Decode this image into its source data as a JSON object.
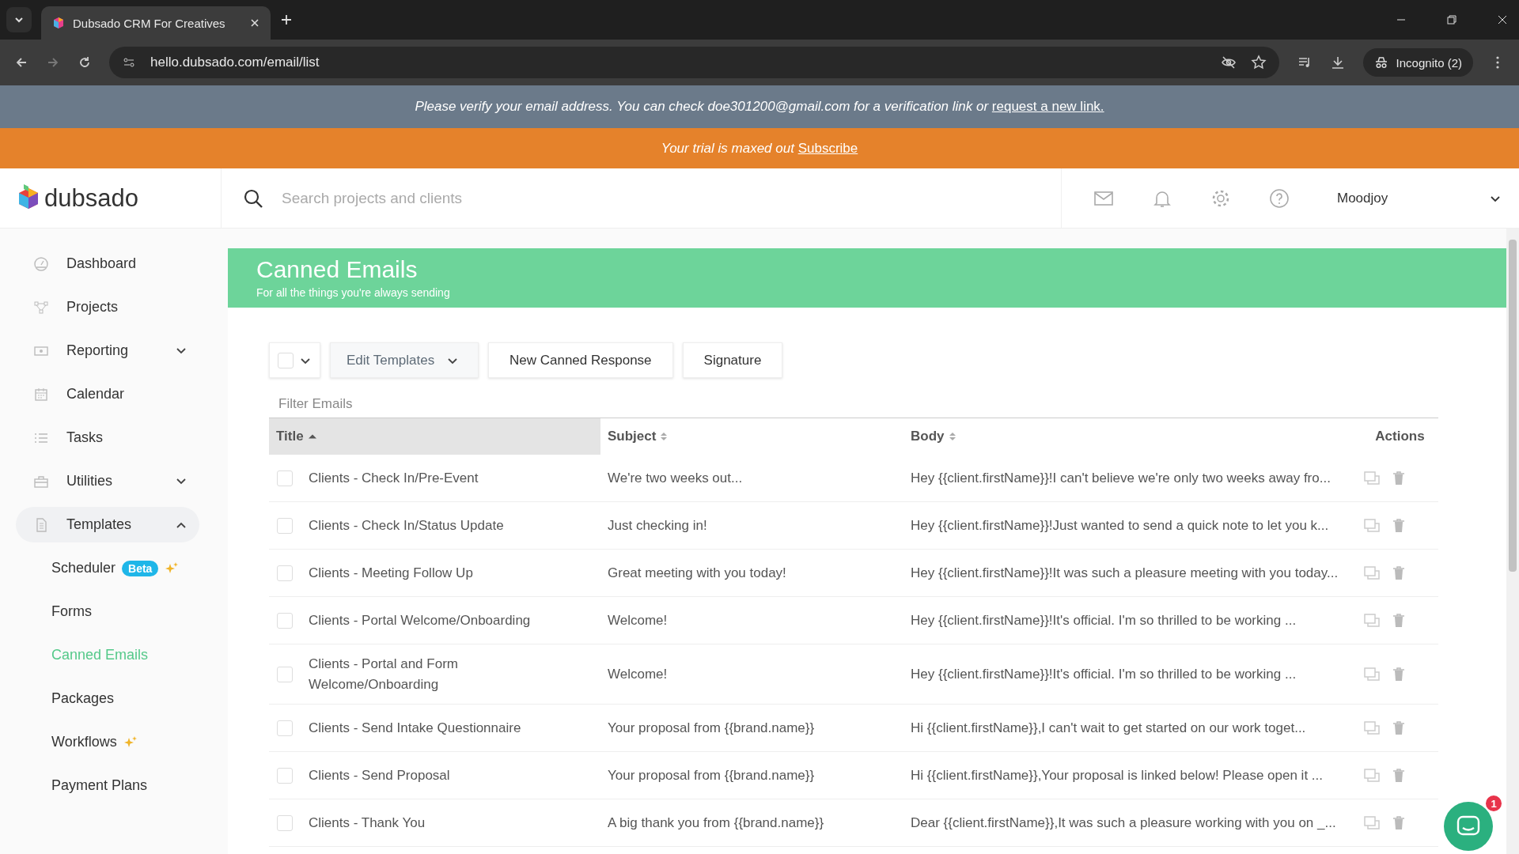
{
  "browser": {
    "tab_title": "Dubsado CRM For Creatives",
    "url": "hello.dubsado.com/email/list",
    "profile": "Incognito (2)"
  },
  "verify_banner": {
    "text": "Please verify your email address. You can check doe301200@gmail.com for a verification link or",
    "link": "request a new link."
  },
  "trial_banner": {
    "text": "Your trial is maxed out",
    "link": "Subscribe"
  },
  "header": {
    "logo": "dubsado",
    "search": {
      "placeholder": "Search projects and clients"
    },
    "user": "Moodjoy"
  },
  "sidebar": {
    "items": [
      {
        "label": "Dashboard",
        "selected": false
      },
      {
        "label": "Projects",
        "selected": false
      },
      {
        "label": "Reporting",
        "selected": false,
        "expanded": false
      },
      {
        "label": "Calendar",
        "selected": false
      },
      {
        "label": "Tasks",
        "selected": false
      },
      {
        "label": "Utilities",
        "selected": false,
        "expanded": false
      },
      {
        "label": "Templates",
        "selected": false,
        "expanded": true,
        "children": [
          {
            "label": "Scheduler",
            "badge": "Beta",
            "sparkle": true,
            "selected": false
          },
          {
            "label": "Forms",
            "selected": false
          },
          {
            "label": "Canned Emails",
            "selected": true
          },
          {
            "label": "Packages",
            "selected": false
          },
          {
            "label": "Workflows",
            "sparkle": true,
            "selected": false
          },
          {
            "label": "Payment Plans",
            "selected": false
          }
        ]
      }
    ]
  },
  "page": {
    "title": "Canned Emails",
    "subtitle": "For all the things you're always sending"
  },
  "toolbar": {
    "select_all": {
      "checked": false
    },
    "buttons": [
      {
        "label": "Edit Templates",
        "kind": "dropdown"
      },
      {
        "label": "New Canned Response",
        "kind": "plain"
      },
      {
        "label": "Signature",
        "kind": "plain"
      }
    ]
  },
  "filter": {
    "placeholder": "Filter Emails"
  },
  "table": {
    "columns": [
      {
        "label": "Title",
        "kind": "sorted"
      },
      {
        "label": "Subject",
        "kind": "sortable"
      },
      {
        "label": "Body",
        "kind": "sortable"
      },
      {
        "label": "Actions",
        "kind": "plain"
      }
    ],
    "rows": [
      {
        "checked": false,
        "title": "Clients - Check In/Pre-Event",
        "subject": "We're two weeks out...",
        "body": "Hey {{client.firstName}}!I can't believe we're only two weeks away fro..."
      },
      {
        "checked": false,
        "title": "Clients - Check In/Status Update",
        "subject": "Just checking in!",
        "body": "Hey {{client.firstName}}!Just wanted to send a quick note to let you k..."
      },
      {
        "checked": false,
        "title": "Clients - Meeting Follow Up",
        "subject": "Great meeting with you today!",
        "body": "Hey {{client.firstName}}!It was such a pleasure meeting with you today..."
      },
      {
        "checked": false,
        "title": "Clients - Portal Welcome/Onboarding",
        "subject": "Welcome!",
        "body": "Hey {{client.firstName}}!It's official. I'm so thrilled to be working ..."
      },
      {
        "checked": false,
        "title": "Clients - Portal and Form Welcome/Onboarding",
        "subject": "Welcome!",
        "body": "Hey {{client.firstName}}!It's official. I'm so thrilled to be working ..."
      },
      {
        "checked": false,
        "title": "Clients - Send Intake Questionnaire",
        "subject": "Your proposal from {{brand.name}}",
        "body": "Hi {{client.firstName}},I can't wait to get started on our work toget..."
      },
      {
        "checked": false,
        "title": "Clients - Send Proposal",
        "subject": "Your proposal from {{brand.name}}",
        "body": "Hi {{client.firstName}},Your proposal is linked below! Please open it ..."
      },
      {
        "checked": false,
        "title": "Clients - Thank You",
        "subject": "A big thank you from {{brand.name}}",
        "body": "Dear {{client.firstName}},It was such a pleasure working with you on _..."
      }
    ]
  },
  "chat": {
    "badge": "1"
  }
}
